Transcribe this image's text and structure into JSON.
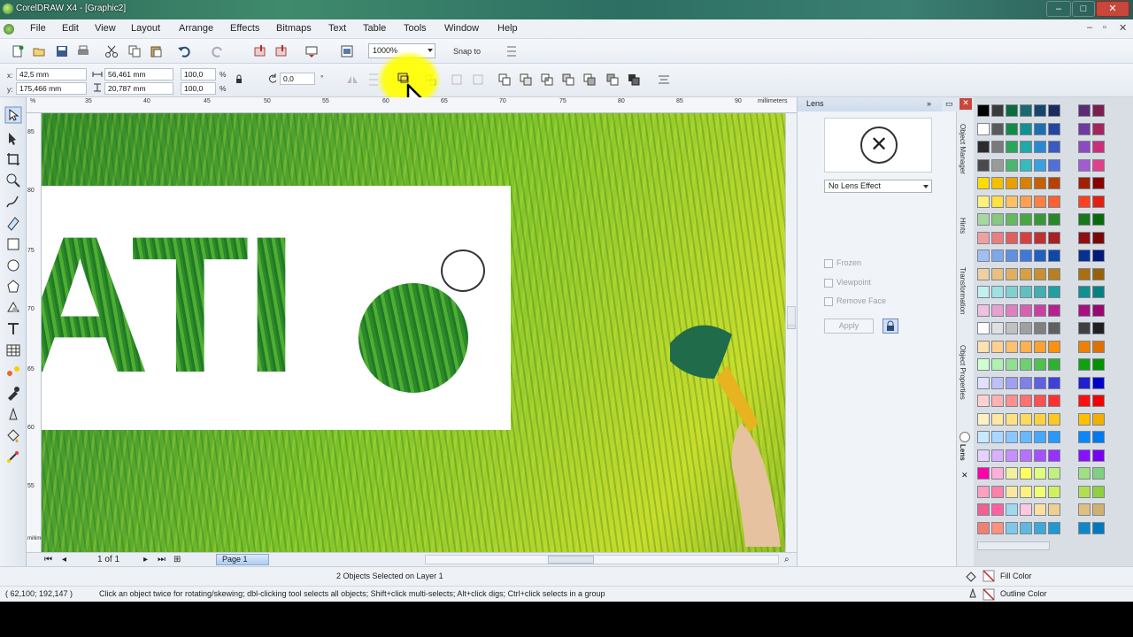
{
  "window": {
    "title": "CorelDRAW X4 - [Graphic2]",
    "min": "–",
    "max": "□",
    "close": "✕"
  },
  "menu": [
    "File",
    "Edit",
    "View",
    "Layout",
    "Arrange",
    "Effects",
    "Bitmaps",
    "Text",
    "Table",
    "Tools",
    "Window",
    "Help"
  ],
  "mdi_controls": [
    "–",
    "▫",
    "✕"
  ],
  "toolbar": {
    "zoom": "1000%",
    "snap_to": "Snap to"
  },
  "propbar": {
    "x_label": "x:",
    "x_value": "42,5 mm",
    "y_label": "y:",
    "y_value": "175,466 mm",
    "w_value": "56,461 mm",
    "h_value": "20,787 mm",
    "scale_w": "100,0",
    "scale_h": "100,0",
    "percent": "%",
    "angle": "0,0",
    "degree": "°"
  },
  "ruler": {
    "h_ticks": [
      "35",
      "40",
      "45",
      "50",
      "55",
      "60",
      "65",
      "70",
      "75",
      "80",
      "85",
      "90"
    ],
    "units": "millimeters",
    "v_ticks": [
      "85",
      "80",
      "75",
      "70",
      "65",
      "60",
      "55",
      "50",
      "45"
    ],
    "v_units": "millimeters"
  },
  "canvas": {
    "letters": "ATI"
  },
  "page_nav": {
    "of": "1 of 1",
    "tab": "Page 1"
  },
  "docker": {
    "title": "Lens",
    "lens_effect": "No Lens Effect",
    "frozen": "Frozen",
    "viewpoint": "Viewpoint",
    "remove_face": "Remove Face",
    "apply": "Apply",
    "tabs": [
      "Object Manager",
      "Hints",
      "Transformation",
      "Object Properties",
      "Lens"
    ]
  },
  "status": {
    "selection": "2 Objects Selected on Layer 1",
    "coords": "( 62,100; 192,147 )",
    "hint": "Click an object twice for rotating/skewing; dbl-clicking tool selects all objects; Shift+click multi-selects; Alt+click digs; Ctrl+click selects in a group",
    "fill_color": "Fill Color",
    "outline_color": "Outline Color"
  },
  "palette_colors": [
    [
      "#000000",
      "#3a3a3a",
      "#0b6b3d",
      "#1a6a70",
      "#17456d",
      "#1a2b5e",
      "#5e2b76",
      "#7a1f4e"
    ],
    [
      "#ffffff",
      "#5a5a5a",
      "#138a4a",
      "#139090",
      "#1d6fb0",
      "#2546a0",
      "#6f3aa0",
      "#a2265e"
    ],
    [
      "#2b2b2b",
      "#7a7a7a",
      "#2aa65a",
      "#21a8a8",
      "#2a8ad0",
      "#3a5ac0",
      "#8c4ac0",
      "#c8307a"
    ],
    [
      "#4a4a4a",
      "#9a9a9a",
      "#49b76f",
      "#37bcbc",
      "#3aa0e0",
      "#5070d8",
      "#a45ad0",
      "#e0408a"
    ],
    [
      "#ffdc00",
      "#f6c000",
      "#e8a000",
      "#d88000",
      "#c86000",
      "#b84000",
      "#a02000",
      "#880000"
    ],
    [
      "#fff07a",
      "#ffe040",
      "#ffc060",
      "#ffa050",
      "#ff8040",
      "#ff6030",
      "#ff4020",
      "#e02010"
    ],
    [
      "#a8d8a0",
      "#88c880",
      "#68b860",
      "#48a840",
      "#389838",
      "#288828",
      "#1a781a",
      "#0a680a"
    ],
    [
      "#f0a0a0",
      "#e88080",
      "#e06060",
      "#d84040",
      "#c03030",
      "#a82020",
      "#901010",
      "#780808"
    ],
    [
      "#a0c0f0",
      "#80a8e8",
      "#6090e0",
      "#4078d8",
      "#2060c0",
      "#1048a8",
      "#083090",
      "#041878"
    ],
    [
      "#f0d0a0",
      "#e8c080",
      "#e0b060",
      "#d8a040",
      "#c89030",
      "#b88020",
      "#a87010",
      "#986008"
    ],
    [
      "#c0f0f0",
      "#a0e0e0",
      "#80d0d0",
      "#60c0c0",
      "#40b0b0",
      "#20a0a0",
      "#109090",
      "#088080"
    ],
    [
      "#f0c0e0",
      "#e8a0d0",
      "#e080c0",
      "#d860b0",
      "#c840a0",
      "#b82090",
      "#a81080",
      "#980870"
    ],
    [
      "#ffffff",
      "#e0e0e0",
      "#c0c0c0",
      "#a0a0a0",
      "#808080",
      "#606060",
      "#404040",
      "#202020"
    ],
    [
      "#ffe0b0",
      "#ffd090",
      "#ffc070",
      "#ffb050",
      "#ffa030",
      "#ff9010",
      "#ef8000",
      "#df7000"
    ],
    [
      "#d0ffd0",
      "#b0f0b0",
      "#90e090",
      "#70d070",
      "#50c050",
      "#30b030",
      "#10a010",
      "#009000"
    ],
    [
      "#e0e0ff",
      "#c0c0f8",
      "#a0a0f0",
      "#8080e8",
      "#6060e0",
      "#4040d8",
      "#2020d0",
      "#0000c8"
    ],
    [
      "#ffd0d0",
      "#ffb0b0",
      "#ff9090",
      "#ff7070",
      "#ff5050",
      "#ff3030",
      "#ff1010",
      "#f00000"
    ],
    [
      "#fff0c0",
      "#ffe8a0",
      "#ffe080",
      "#ffd860",
      "#ffd040",
      "#ffc820",
      "#ffc000",
      "#f0b000"
    ],
    [
      "#c8e8ff",
      "#a8d8ff",
      "#88c8ff",
      "#68b8ff",
      "#48a8ff",
      "#2898ff",
      "#0888ff",
      "#0078ef"
    ],
    [
      "#e8d0ff",
      "#d8b0ff",
      "#c890ff",
      "#b870ff",
      "#a850ff",
      "#9830ff",
      "#8810ff",
      "#7800ef"
    ],
    [
      "#ff00aa",
      "#ffb0d8",
      "#f0f0a0",
      "#ffff60",
      "#e0ff80",
      "#c0f080",
      "#a0e080",
      "#80d080"
    ],
    [
      "#ffa0c0",
      "#ff80a8",
      "#f8e8a0",
      "#fff080",
      "#f0ff70",
      "#d0f060",
      "#b0e050",
      "#90d040"
    ],
    [
      "#f06090",
      "#ff60a0",
      "#a0d8f0",
      "#ffc8e0",
      "#ffe0a0",
      "#f0d090",
      "#e0c080",
      "#d0b070"
    ],
    [
      "#f08070",
      "#ff9080",
      "#80c8e8",
      "#60b8e0",
      "#40a8d8",
      "#2098d0",
      "#1088c8",
      "#0078c0"
    ]
  ]
}
